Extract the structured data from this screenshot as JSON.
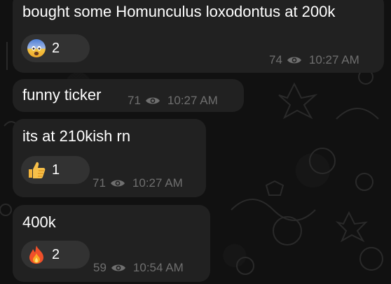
{
  "messages": [
    {
      "text": "bought some Homunculus loxodontus at 200k",
      "reaction": {
        "icon": "fearful-face-emoji",
        "count": "2"
      },
      "views": "74",
      "time": "10:27 AM"
    },
    {
      "text": "funny ticker",
      "views": "71",
      "time": "10:27 AM"
    },
    {
      "text": "its at 210kish rn",
      "reaction": {
        "icon": "thumbs-up-emoji",
        "count": "1"
      },
      "views": "71",
      "time": "10:27 AM"
    },
    {
      "text": "400k",
      "reaction": {
        "icon": "fire-emoji",
        "count": "2"
      },
      "views": "59",
      "time": "10:54 AM"
    }
  ],
  "colors": {
    "background": "#121212",
    "bubble": "#212121",
    "reaction_pill": "#323232",
    "meta_text": "#6f6f6f"
  }
}
